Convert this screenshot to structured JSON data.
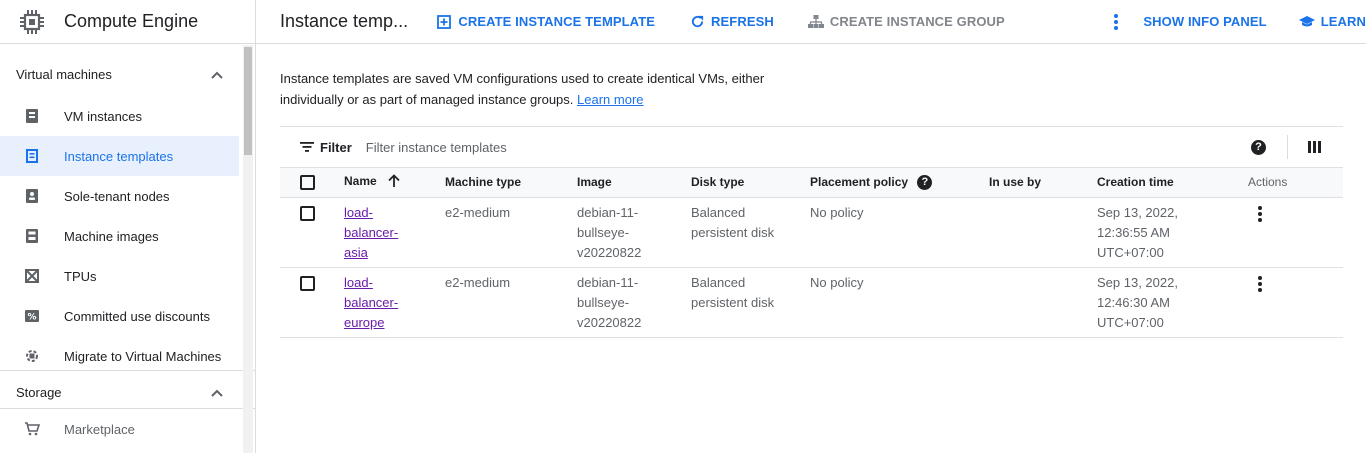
{
  "product": {
    "name": "Compute Engine",
    "logo_icon": "compute-engine-chip-icon"
  },
  "sidebar": {
    "sections": [
      {
        "label": "Virtual machines",
        "expanded": true
      },
      {
        "label": "Storage",
        "expanded": true
      }
    ],
    "vm_items": [
      {
        "label": "VM instances",
        "icon": "vm-instances-icon"
      },
      {
        "label": "Instance templates",
        "icon": "instance-templates-icon",
        "active": true
      },
      {
        "label": "Sole-tenant nodes",
        "icon": "sole-tenant-icon"
      },
      {
        "label": "Machine images",
        "icon": "machine-images-icon"
      },
      {
        "label": "TPUs",
        "icon": "tpu-icon"
      },
      {
        "label": "Committed use discounts",
        "icon": "discount-icon"
      },
      {
        "label": "Migrate to Virtual Machines",
        "icon": "migrate-icon"
      }
    ],
    "storage_items": [
      {
        "label": "Marketplace",
        "icon": "marketplace-cart-icon"
      }
    ]
  },
  "header": {
    "title": "Instance temp...",
    "create_template": "CREATE INSTANCE TEMPLATE",
    "refresh": "REFRESH",
    "create_group": "CREATE INSTANCE GROUP",
    "show_info_panel": "SHOW INFO PANEL",
    "learn": "LEARN"
  },
  "main": {
    "description": "Instance templates are saved VM configurations used to create identical VMs, either individually or as part of managed instance groups.",
    "learn_more": "Learn more",
    "filter": {
      "label": "Filter",
      "placeholder": "Filter instance templates"
    }
  },
  "table": {
    "columns": {
      "name": "Name",
      "machine_type": "Machine type",
      "image": "Image",
      "disk_type": "Disk type",
      "placement_policy": "Placement policy",
      "in_use_by": "In use by",
      "creation_time": "Creation time",
      "actions": "Actions"
    },
    "rows": [
      {
        "name_lines": [
          "load-",
          "balancer-",
          "asia"
        ],
        "machine_type": "e2-medium",
        "image_lines": [
          "debian-11-",
          "bullseye-",
          "v20220822"
        ],
        "disk_lines": [
          "Balanced",
          "persistent disk"
        ],
        "placement_policy": "No policy",
        "in_use_by": "",
        "creation_lines": [
          "Sep 13, 2022,",
          "12:36:55 AM",
          "UTC+07:00"
        ]
      },
      {
        "name_lines": [
          "load-",
          "balancer-",
          "europe"
        ],
        "machine_type": "e2-medium",
        "image_lines": [
          "debian-11-",
          "bullseye-",
          "v20220822"
        ],
        "disk_lines": [
          "Balanced",
          "persistent disk"
        ],
        "placement_policy": "No policy",
        "in_use_by": "",
        "creation_lines": [
          "Sep 13, 2022,",
          "12:46:30 AM",
          "UTC+07:00"
        ]
      }
    ]
  },
  "colors": {
    "accent": "#1a73e8",
    "active_bg": "#e8f0fe",
    "visited_link": "#681da8",
    "disabled": "#80868b"
  }
}
